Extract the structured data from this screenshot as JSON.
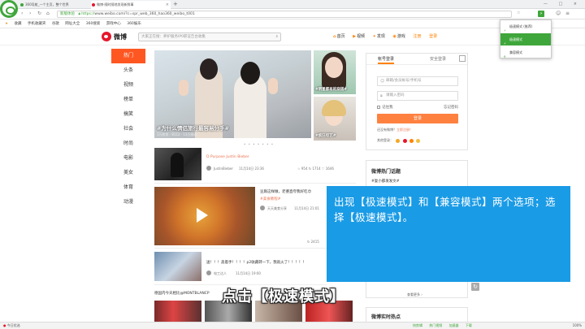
{
  "browser": {
    "tabs": [
      {
        "label": "360导航_一个主页，整个世界"
      },
      {
        "label": "微博-随时随地发现新鲜事"
      }
    ],
    "new_tab": "+",
    "window_controls": "— □ ×",
    "address": {
      "secure_badge": "新版体验",
      "protocol": "https://",
      "url_rest": "www.weibo.com/?c=spr_web_360_hao360_weibo_t001"
    },
    "bookmarks": [
      "收藏",
      "手机收藏夹",
      "谷歌",
      "网址大全",
      "360搜索",
      "游戏中心",
      "360娱乐"
    ],
    "mode_dropdown": {
      "items": [
        {
          "label": "极速模式 (推荐)",
          "active": false
        },
        {
          "label": "极速模式",
          "active": true
        },
        {
          "label": "兼容模式",
          "active": false
        }
      ]
    }
  },
  "weibo": {
    "logo_text": "微博",
    "search_placeholder": "大家正在搜：养护服务IP0职证告台收集",
    "nav": [
      {
        "icon": "⌂",
        "label": "首页"
      },
      {
        "icon": "▶",
        "label": "视频"
      },
      {
        "icon": "✦",
        "label": "发现"
      },
      {
        "icon": "◉",
        "label": "游戏"
      },
      {
        "icon": "",
        "label": "注册"
      },
      {
        "icon": "",
        "label": "登录"
      }
    ],
    "left_nav": [
      "热门",
      "头条",
      "视频",
      "榜单",
      "搞笑",
      "社会",
      "时尚",
      "电影",
      "美女",
      "体育",
      "动漫"
    ],
    "hero": {
      "caption": "#为什么情侣旅行最容易分手#",
      "stats": "1万转发 · 8112 · 13万阅读"
    },
    "side_cards": [
      {
        "caption": "#明星都有的穿搭#"
      },
      {
        "caption": "#疯狂综艺#"
      }
    ],
    "carousel_dots": "• • • • • • •",
    "feed": [
      {
        "title": "D Purpose Justin Bieber",
        "author": "JustinBieber",
        "time": "11月14日 23:36",
        "stats": "☆ 954  ↻ 1714  ♡ 1646"
      },
      {
        "title": "豆腐这样做，老婆直夸我好吃😍",
        "tag": "#美食教程#",
        "author": "天天美食分享",
        "time": "11月14日 21:01",
        "stats": "↻ 2415"
      },
      {
        "title": "送！！！盖着手！！！！p2收藏转一下，我就火了！！！！！",
        "author": "电工达人",
        "time": "11月14日 19:00"
      },
      {
        "title": "德国内今天相比@MONTBLANCP"
      }
    ],
    "login": {
      "tab_account": "帐号登录",
      "tab_secure": "安全登录",
      "username_placeholder": "邮箱/会员帐号/手机号",
      "password_placeholder": "请输入密码",
      "remember": "记住我",
      "forgot": "忘记密码",
      "submit": "登录",
      "register_prompt": "还没有微博？",
      "register_link": "立即注册！",
      "other_login": "其他登录："
    },
    "hot_topics": {
      "title": "微博热门话题",
      "first_item": "#复小都发发文#",
      "more": "查看更多 ›"
    },
    "hot_search": {
      "title": "微博实时热点"
    }
  },
  "overlay": {
    "instruction": "出现【极速模式】和【兼容模式】两个选项；选择【极速模式】。",
    "caption": "点击【极速模式】"
  },
  "statusbar": {
    "left": "今日优选",
    "right_items": [
      "快剪辑",
      "热门视频",
      "加速器",
      "下载"
    ],
    "zoom": "100%"
  },
  "colors": {
    "browser_green": "#3fa63b",
    "weibo_orange": "#ff8200",
    "nav_selected": "#ff5722",
    "login_button": "#ff8140",
    "instruction_blue": "#1a9be6"
  }
}
